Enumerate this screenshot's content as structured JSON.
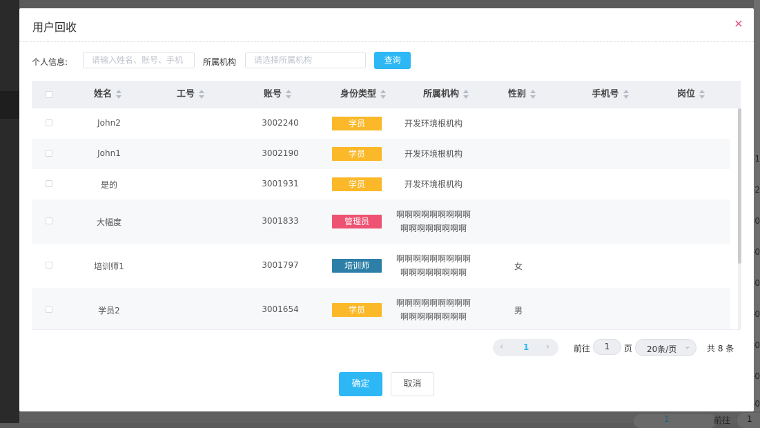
{
  "background": {
    "right_edge_values": [
      "-1",
      "-2",
      "-0",
      "-0",
      "-0",
      "-0",
      "-0",
      "-0",
      "-0"
    ],
    "bottom_pager": {
      "page": "1",
      "goto_label": "前往",
      "goto_value": "1"
    }
  },
  "dialog": {
    "title": "用户回收",
    "close_icon": "close-icon ×"
  },
  "filter": {
    "personal_label": "个人信息:",
    "personal_placeholder": "请输入姓名、账号、手机",
    "org_label": "所属机构",
    "org_placeholder": "请选择所属机构",
    "search_label": "查询"
  },
  "table": {
    "columns": [
      "姓名",
      "工号",
      "账号",
      "身份类型",
      "所属机构",
      "性别",
      "手机号",
      "岗位"
    ],
    "rows": [
      {
        "name": "John2",
        "staff_no": "",
        "account": "3002240",
        "identity": "学员",
        "identity_color": "#fbb829",
        "org": [
          "开发环境根机构"
        ],
        "gender": "",
        "phone": "",
        "post": ""
      },
      {
        "name": "John1",
        "staff_no": "",
        "account": "3002190",
        "identity": "学员",
        "identity_color": "#fbb829",
        "org": [
          "开发环境根机构"
        ],
        "gender": "",
        "phone": "",
        "post": ""
      },
      {
        "name": "是的",
        "staff_no": "",
        "account": "3001931",
        "identity": "学员",
        "identity_color": "#fbb829",
        "org": [
          "开发环境根机构"
        ],
        "gender": "",
        "phone": "",
        "post": ""
      },
      {
        "name": "大幅度",
        "staff_no": "",
        "account": "3001833",
        "identity": "管理员",
        "identity_color": "#ee5272",
        "org": [
          "啊啊啊啊啊啊啊啊啊",
          "啊啊啊啊啊啊啊啊"
        ],
        "gender": "",
        "phone": "",
        "post": ""
      },
      {
        "name": "培训师1",
        "staff_no": "",
        "account": "3001797",
        "identity": "培训师",
        "identity_color": "#2d7fa8",
        "org": [
          "啊啊啊啊啊啊啊啊啊",
          "啊啊啊啊啊啊啊啊"
        ],
        "gender": "女",
        "phone": "",
        "post": ""
      },
      {
        "name": "学员2",
        "staff_no": "",
        "account": "3001654",
        "identity": "学员",
        "identity_color": "#fbb829",
        "org": [
          "啊啊啊啊啊啊啊啊啊",
          "啊啊啊啊啊啊啊啊"
        ],
        "gender": "男",
        "phone": "",
        "post": ""
      }
    ]
  },
  "pagination": {
    "prev_icon": "chevron-left-icon",
    "next_icon": "chevron-right-icon",
    "current_page": "1",
    "goto_label": "前往",
    "goto_value": "1",
    "page_label": "页",
    "page_size": "20条/页",
    "total": "共 8 条"
  },
  "footer": {
    "confirm_label": "确定",
    "cancel_label": "取消"
  },
  "colors": {
    "primary": "#2db7f5",
    "student": "#fbb829",
    "admin": "#ee5272",
    "trainer": "#2d7fa8"
  }
}
